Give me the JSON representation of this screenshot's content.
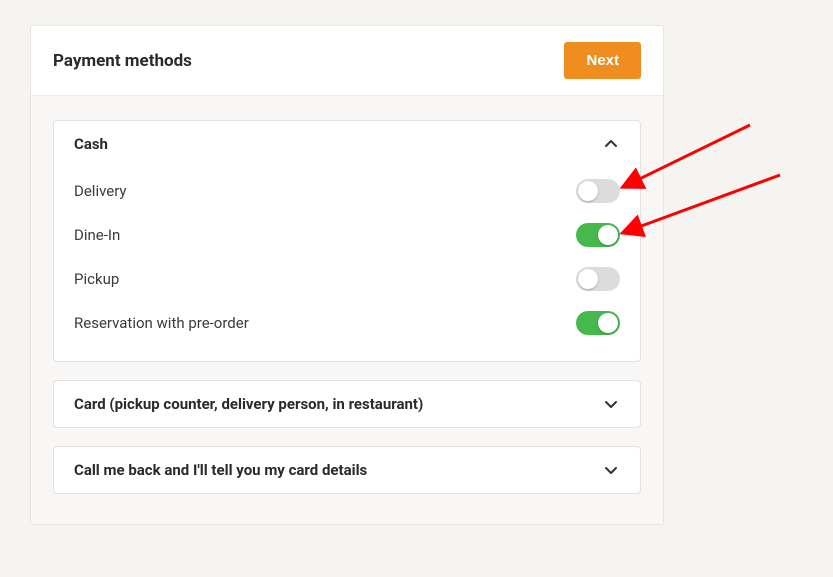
{
  "header": {
    "title": "Payment methods",
    "next_label": "Next"
  },
  "panels": {
    "cash": {
      "title": "Cash",
      "expanded": true,
      "options": [
        {
          "label": "Delivery",
          "on": false
        },
        {
          "label": "Dine-In",
          "on": true
        },
        {
          "label": "Pickup",
          "on": false
        },
        {
          "label": "Reservation with pre-order",
          "on": true
        }
      ]
    },
    "card": {
      "title": "Card (pickup counter, delivery person, in restaurant)",
      "expanded": false
    },
    "callback": {
      "title": "Call me back and I'll tell you my card details",
      "expanded": false
    }
  },
  "annotations": {
    "arrow_color": "#ff0000"
  }
}
